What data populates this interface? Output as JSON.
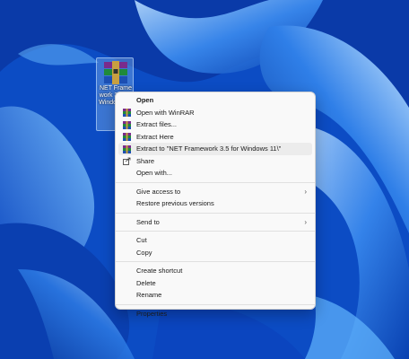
{
  "desktop": {
    "icon_label": "NET Framework 3.5 for Windows 11"
  },
  "context_menu": {
    "group1": [
      {
        "label": "Open",
        "icon": "",
        "bold": true
      },
      {
        "label": "Open with WinRAR",
        "icon": "winrar-icon"
      },
      {
        "label": "Extract files...",
        "icon": "winrar-icon"
      },
      {
        "label": "Extract Here",
        "icon": "winrar-icon"
      },
      {
        "label": "Extract to \"NET Framework 3.5 for Windows 11\\\"",
        "icon": "winrar-icon",
        "highlighted": true
      },
      {
        "label": "Share",
        "icon": "share-icon"
      },
      {
        "label": "Open with...",
        "icon": ""
      }
    ],
    "group2": [
      {
        "label": "Give access to",
        "submenu": true
      },
      {
        "label": "Restore previous versions"
      }
    ],
    "group3": [
      {
        "label": "Send to",
        "submenu": true
      }
    ],
    "group4": [
      {
        "label": "Cut"
      },
      {
        "label": "Copy"
      }
    ],
    "group5": [
      {
        "label": "Create shortcut"
      },
      {
        "label": "Delete"
      },
      {
        "label": "Rename"
      }
    ],
    "group6": [
      {
        "label": "Properties"
      }
    ]
  },
  "colors": {
    "wallpaper_dark": "#0a3fb0",
    "wallpaper_light": "#6cc3ff",
    "menu_bg": "#f9f9f9"
  }
}
